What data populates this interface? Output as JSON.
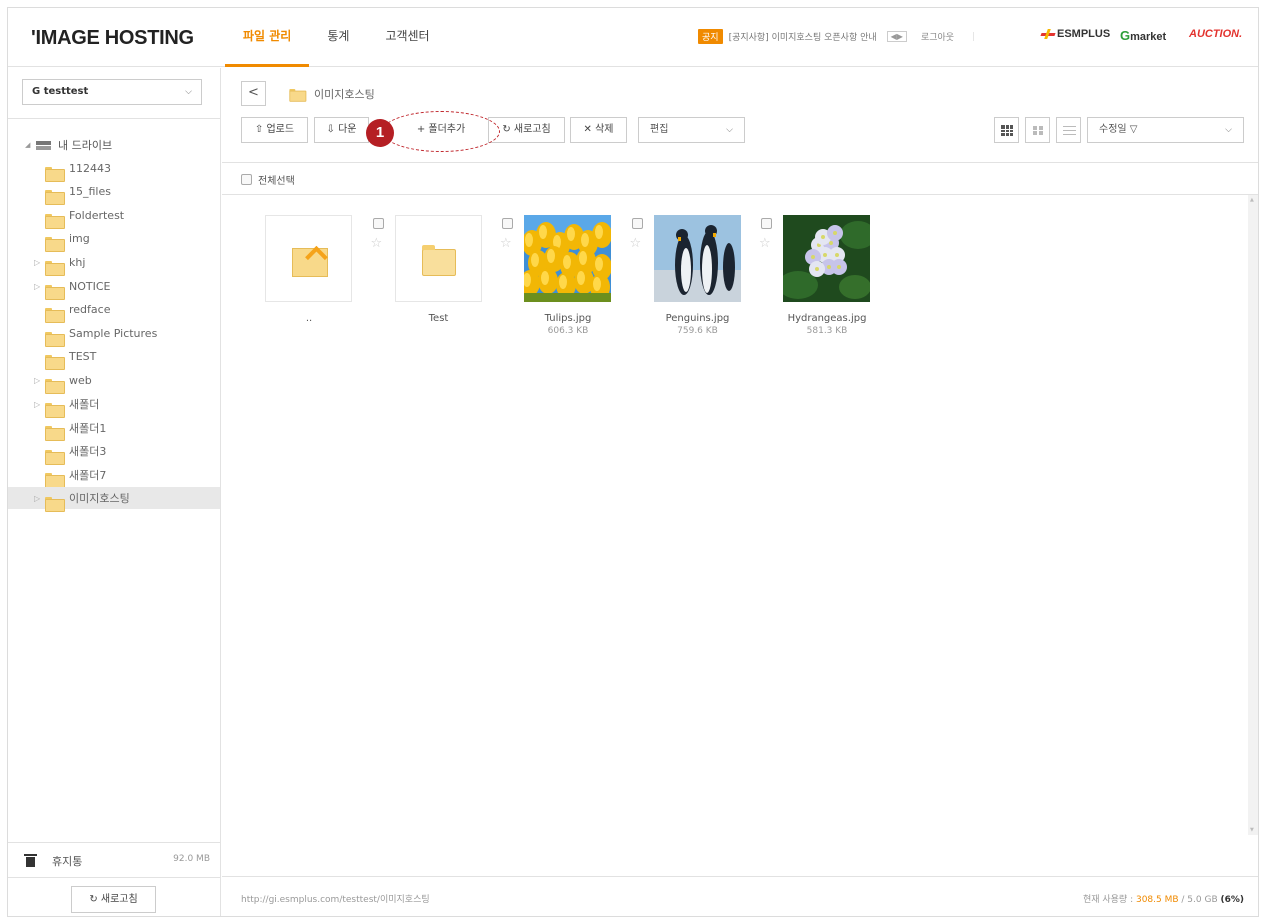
{
  "header": {
    "logo": "'IMAGE HOSTING",
    "nav": [
      {
        "label": "파일 관리",
        "active": true
      },
      {
        "label": "통계",
        "active": false
      },
      {
        "label": "고객센터",
        "active": false
      }
    ],
    "notice_badge": "공지",
    "notice_text": "[공지사항] 이미지호스팅 오픈사항 안내",
    "notice_arrows": "◀▶",
    "logout": "로그아웃",
    "partners": {
      "esmplus": "ESMPLUS",
      "gmarket_g": "G",
      "gmarket": "market",
      "auction": "AUCTION."
    },
    "accent_color": "#f08a00"
  },
  "sidebar": {
    "account": "G testtest",
    "root": "내 드라이브",
    "folders": [
      {
        "label": "112443",
        "expandable": false
      },
      {
        "label": "15_files",
        "expandable": false
      },
      {
        "label": "Foldertest",
        "expandable": false
      },
      {
        "label": "img",
        "expandable": false
      },
      {
        "label": "khj",
        "expandable": true
      },
      {
        "label": "NOTICE",
        "expandable": true
      },
      {
        "label": "redface",
        "expandable": false
      },
      {
        "label": "Sample Pictures",
        "expandable": false
      },
      {
        "label": "TEST",
        "expandable": false
      },
      {
        "label": "web",
        "expandable": true
      },
      {
        "label": "새폴더",
        "expandable": true
      },
      {
        "label": "새폴더1",
        "expandable": false
      },
      {
        "label": "새폴더3",
        "expandable": false
      },
      {
        "label": "새폴더7",
        "expandable": false
      },
      {
        "label": "이미지호스팅",
        "expandable": true,
        "selected": true
      }
    ],
    "trash_label": "휴지통",
    "trash_size": "92.0 MB",
    "refresh_label": "↻ 새로고침"
  },
  "main": {
    "back": "<",
    "breadcrumb": "이미지호스팅",
    "toolbar": {
      "upload": "⇧ 업로드",
      "download": "⇩ 다운",
      "new_folder": "+ 폴더추가",
      "refresh": "↻ 새로고침",
      "delete": "✕ 삭제",
      "edit": "편집",
      "sort": "수정일 ▽"
    },
    "callout_number": "1",
    "select_all": "전체선택",
    "items": [
      {
        "name": "..",
        "size": "",
        "kind": "parent"
      },
      {
        "name": "Test",
        "size": "",
        "kind": "folder"
      },
      {
        "name": "Tulips.jpg",
        "size": "606.3 KB",
        "kind": "tulips"
      },
      {
        "name": "Penguins.jpg",
        "size": "759.6 KB",
        "kind": "penguins"
      },
      {
        "name": "Hydrangeas.jpg",
        "size": "581.3 KB",
        "kind": "hydrangeas"
      }
    ],
    "url": "http://gi.esmplus.com/testtest/이미지호스팅",
    "usage_label": "현재 사용량 : ",
    "usage_used": "308.5 MB",
    "usage_total": " / 5.0 GB ",
    "usage_pct": "(6%)"
  }
}
